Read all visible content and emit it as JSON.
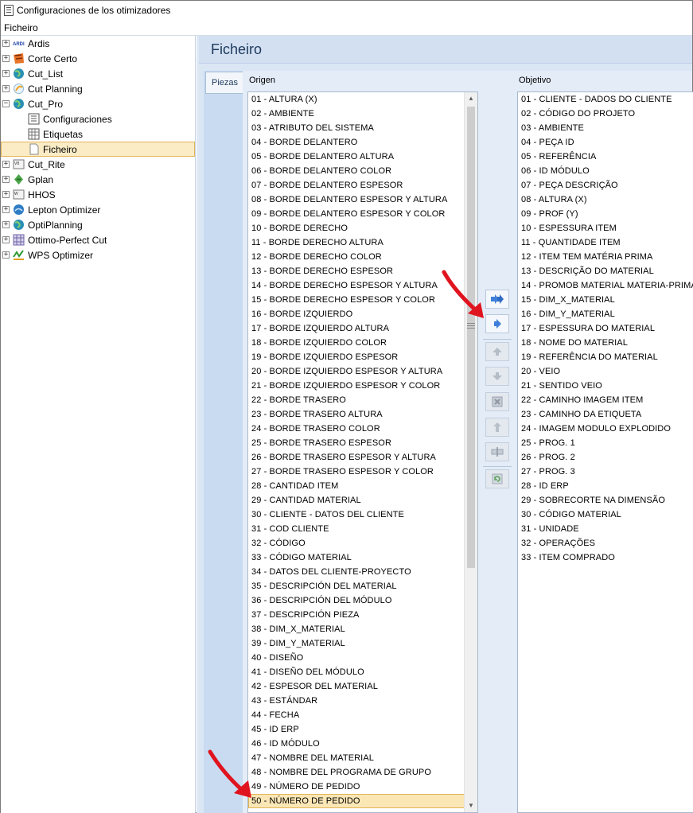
{
  "window": {
    "title": "Configuraciones de los otimizadores"
  },
  "menu": {
    "file": "Ficheiro"
  },
  "tree": [
    {
      "label": "Ardis",
      "icon": "ardis-logo-icon",
      "expander": "+"
    },
    {
      "label": "Corte Certo",
      "icon": "corte-certo-icon",
      "expander": "+"
    },
    {
      "label": "Cut_List",
      "icon": "globe-icon",
      "expander": "+"
    },
    {
      "label": "Cut Planning",
      "icon": "cut-planning-icon",
      "expander": "+"
    },
    {
      "label": "Cut_Pro",
      "icon": "globe-icon",
      "expander": "−"
    },
    {
      "label": "Configuraciones",
      "icon": "settings-grid-icon",
      "child": true
    },
    {
      "label": "Etiquetas",
      "icon": "label-grid-icon",
      "child": true
    },
    {
      "label": "Ficheiro",
      "icon": "file-icon",
      "child": true,
      "selected": true
    },
    {
      "label": "Cut_Rite",
      "icon": "cut-rite-icon",
      "expander": "+"
    },
    {
      "label": "Gplan",
      "icon": "gplan-icon",
      "expander": "+"
    },
    {
      "label": "HHOS",
      "icon": "hhos-icon",
      "expander": "+"
    },
    {
      "label": "Lepton Optimizer",
      "icon": "lepton-icon",
      "expander": "+"
    },
    {
      "label": "OptiPlanning",
      "icon": "globe-icon",
      "expander": "+"
    },
    {
      "label": "Ottimo-Perfect Cut",
      "icon": "ottimo-icon",
      "expander": "+"
    },
    {
      "label": "WPS Optimizer",
      "icon": "wps-icon",
      "expander": "+"
    }
  ],
  "main": {
    "header": "Ficheiro",
    "tab": "Piezas",
    "origin_label": "Origen",
    "target_label": "Objetivo",
    "origin_items": [
      "01 - ALTURA (X)",
      "02 - AMBIENTE",
      "03 - ATRIBUTO DEL SISTEMA",
      "04 - BORDE DELANTERO",
      "05 - BORDE DELANTERO ALTURA",
      "06 - BORDE DELANTERO COLOR",
      "07 - BORDE DELANTERO ESPESOR",
      "08 - BORDE DELANTERO ESPESOR Y ALTURA",
      "09 - BORDE DELANTERO ESPESOR Y COLOR",
      "10 - BORDE DERECHO",
      "11 - BORDE DERECHO ALTURA",
      "12 - BORDE DERECHO COLOR",
      "13 - BORDE DERECHO ESPESOR",
      "14 - BORDE DERECHO ESPESOR Y ALTURA",
      "15 - BORDE DERECHO ESPESOR Y COLOR",
      "16 - BORDE IZQUIERDO",
      "17 - BORDE IZQUIERDO ALTURA",
      "18 - BORDE IZQUIERDO COLOR",
      "19 - BORDE IZQUIERDO ESPESOR",
      "20 - BORDE IZQUIERDO ESPESOR Y ALTURA",
      "21 - BORDE IZQUIERDO ESPESOR Y COLOR",
      "22 - BORDE TRASERO",
      "23 - BORDE TRASERO ALTURA",
      "24 - BORDE TRASERO COLOR",
      "25 - BORDE TRASERO ESPESOR",
      "26 - BORDE TRASERO ESPESOR Y ALTURA",
      "27 - BORDE TRASERO ESPESOR Y COLOR",
      "28 - CANTIDAD ITEM",
      "29 - CANTIDAD MATERIAL",
      "30 - CLIENTE - DATOS DEL CLIENTE",
      "31 - COD CLIENTE",
      "32 - CÓDIGO",
      "33 - CÓDIGO MATERIAL",
      "34 - DATOS DEL CLIENTE-PROYECTO",
      "35 - DESCRIPCIÓN DEL MATERIAL",
      "36 - DESCRIPCIÓN DEL MÓDULO",
      "37 - DESCRIPCIÓN PIEZA",
      "38 - DIM_X_MATERIAL",
      "39 - DIM_Y_MATERIAL",
      "40 - DISEÑO",
      "41 - DISEÑO DEL MÓDULO",
      "42 - ESPESOR DEL MATERIAL",
      "43 - ESTÁNDAR",
      "44 - FECHA",
      "45 - ID ERP",
      "46 - ID MÓDULO",
      "47 - NOMBRE DEL MATERIAL",
      "48 - NOMBRE DEL PROGRAMA DE GRUPO",
      "49 - NÚMERO DE PEDIDO",
      "50 - NÚMERO DE PEDIDO"
    ],
    "selected_origin_index": 49,
    "target_items": [
      "01 - CLIENTE - DADOS DO CLIENTE",
      "02 - CÓDIGO DO PROJETO",
      "03 - AMBIENTE",
      "04 - PEÇA ID",
      "05 - REFERÊNCIA",
      "06 - ID MÓDULO",
      "07 - PEÇA DESCRIÇÃO",
      "08 - ALTURA (X)",
      "09 - PROF (Y)",
      "10 - ESPESSURA ITEM",
      "11 - QUANTIDADE ITEM",
      "12 - ITEM TEM MATÉRIA PRIMA",
      "13 - DESCRIÇÃO DO MATERIAL",
      "14 - PROMOB MATERIAL MATERIA-PRIMA",
      "15 - DIM_X_MATERIAL",
      "16 - DIM_Y_MATERIAL",
      "17 - ESPESSURA DO MATERIAL",
      "18 - NOME DO MATERIAL",
      "19 - REFERÊNCIA DO MATERIAL",
      "20 - VEIO",
      "21 - SENTIDO VEIO",
      "22 - CAMINHO IMAGEM ITEM",
      "23 - CAMINHO DA ETIQUETA",
      "24 - IMAGEM MODULO EXPLODIDO",
      "25 - PROG. 1",
      "26 - PROG. 2",
      "27 - PROG. 3",
      "28 - ID ERP",
      "29 - SOBRECORTE NA DIMENSÃO",
      "30 - CÓDIGO MATERIAL",
      "31 - UNIDADE",
      "32 - OPERAÇÕES",
      "33 - ITEM COMPRADO"
    ]
  },
  "colors": {
    "accent": "#e3b456",
    "selection": "#fbe7b6",
    "panel": "#dbe6f4",
    "annotation_arrow": "#e0141e"
  }
}
